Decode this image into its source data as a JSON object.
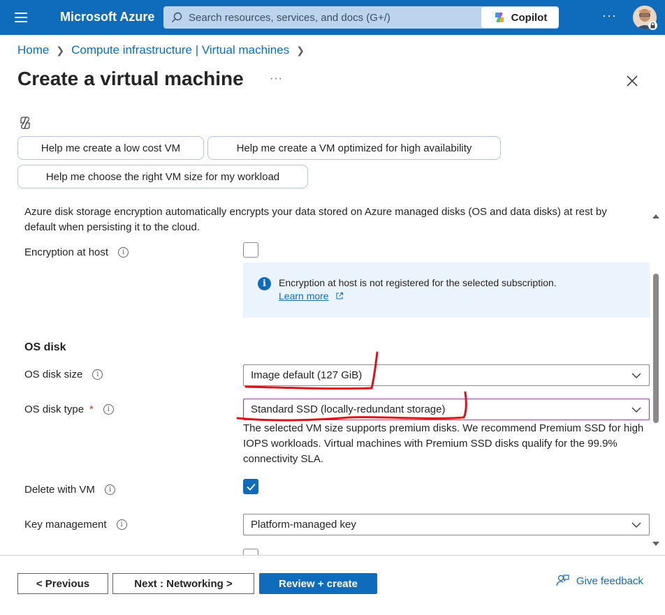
{
  "topbar": {
    "brand": "Microsoft Azure",
    "search_placeholder": "Search resources, services, and docs (G+/)",
    "copilot_label": "Copilot",
    "more_label": "···"
  },
  "breadcrumb": {
    "items": [
      "Home",
      "Compute infrastructure | Virtual machines"
    ]
  },
  "page": {
    "title": "Create a virtual machine",
    "more_label": "···"
  },
  "suggestions": [
    "Help me create a low cost VM",
    "Help me create a VM optimized for high availability",
    "Help me choose the right VM size for my workload"
  ],
  "disk_encryption": {
    "description": "Azure disk storage encryption automatically encrypts your data stored on Azure managed disks (OS and data disks) at rest by default when persisting it to the cloud.",
    "encryption_at_host_label": "Encryption at host",
    "encryption_at_host_checked": false,
    "info_message": "Encryption at host is not registered for the selected subscription.",
    "info_link": "Learn more"
  },
  "os_disk": {
    "section_title": "OS disk",
    "size_label": "OS disk size",
    "size_value": "Image default (127 GiB)",
    "type_label": "OS disk type",
    "type_required": "*",
    "type_value": "Standard SSD (locally-redundant storage)",
    "type_hint": "The selected VM size supports premium disks. We recommend Premium SSD for high IOPS workloads. Virtual machines with Premium SSD disks qualify for the 99.9% connectivity SLA.",
    "delete_with_vm_label": "Delete with VM",
    "delete_with_vm_checked": true,
    "key_mgmt_label": "Key management",
    "key_mgmt_value": "Platform-managed key"
  },
  "footer": {
    "previous_label": "< Previous",
    "next_label": "Next : Networking >",
    "review_label": "Review + create",
    "feedback_label": "Give feedback"
  },
  "colors": {
    "brand_blue": "#0f6cbd",
    "annotation_red": "#e0101a",
    "info_bg": "#ebf3fc"
  }
}
